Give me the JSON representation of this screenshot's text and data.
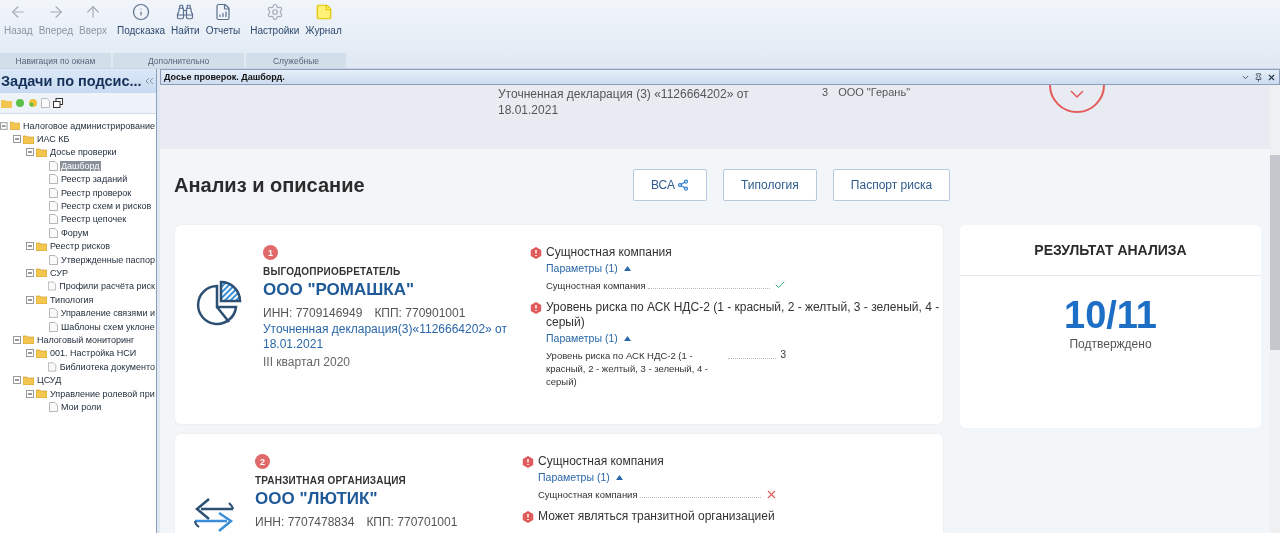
{
  "toolbar": {
    "groups": [
      {
        "label": "Навигация по окнам",
        "buttons": [
          {
            "kind": "back",
            "label": "Назад",
            "disabled": true
          },
          {
            "kind": "forward",
            "label": "Вперед",
            "disabled": true
          },
          {
            "kind": "up",
            "label": "Вверх",
            "disabled": true
          }
        ]
      },
      {
        "label": "Дополнительно",
        "buttons": [
          {
            "kind": "info",
            "label": "Подсказка",
            "disabled": false
          },
          {
            "kind": "find",
            "label": "Найти",
            "disabled": false
          },
          {
            "kind": "reports",
            "label": "Отчеты",
            "disabled": false
          }
        ]
      },
      {
        "label": "Служебные",
        "buttons": [
          {
            "kind": "settings",
            "label": "Настройки",
            "disabled": false
          },
          {
            "kind": "journal",
            "label": "Журнал",
            "disabled": false
          }
        ]
      }
    ]
  },
  "sidebar": {
    "title": "Задачи по подсис...",
    "tree": [
      {
        "label": "Налоговое администрирование",
        "kind": "folder",
        "expanded": true,
        "selected": false,
        "children": [
          {
            "label": "ИАС КБ",
            "kind": "folder",
            "expanded": true,
            "selected": false,
            "children": [
              {
                "label": "Досье проверки",
                "kind": "folder",
                "expanded": true,
                "selected": false,
                "children": [
                  {
                    "label": "Дашборд",
                    "kind": "page",
                    "selected": true
                  },
                  {
                    "label": "Реестр заданий",
                    "kind": "page",
                    "selected": false
                  },
                  {
                    "label": "Реестр проверок",
                    "kind": "page",
                    "selected": false
                  },
                  {
                    "label": "Реестр схем и рисков",
                    "kind": "page",
                    "selected": false
                  },
                  {
                    "label": "Реестр цепочек",
                    "kind": "page",
                    "selected": false
                  },
                  {
                    "label": "Форум",
                    "kind": "page",
                    "selected": false
                  }
                ]
              },
              {
                "label": "Реестр рисков",
                "kind": "folder",
                "expanded": true,
                "selected": false,
                "children": [
                  {
                    "label": "Утвержденные паспор",
                    "kind": "page",
                    "selected": false
                  }
                ]
              },
              {
                "label": "СУР",
                "kind": "folder",
                "expanded": true,
                "selected": false,
                "children": [
                  {
                    "label": "Профили расчёта риск",
                    "kind": "page",
                    "selected": false
                  }
                ]
              },
              {
                "label": "Типология",
                "kind": "folder",
                "expanded": true,
                "selected": false,
                "children": [
                  {
                    "label": "Управление связями и",
                    "kind": "page",
                    "selected": false
                  },
                  {
                    "label": "Шаблоны схем уклоне",
                    "kind": "page",
                    "selected": false
                  }
                ]
              }
            ]
          },
          {
            "label": "Налоговый мониторинг",
            "kind": "folder",
            "expanded": true,
            "selected": false,
            "children": [
              {
                "label": "001. Настройка НСИ",
                "kind": "folder",
                "expanded": true,
                "selected": false,
                "children": [
                  {
                    "label": "Библиотека документо",
                    "kind": "page",
                    "selected": false
                  }
                ]
              }
            ]
          },
          {
            "label": "ЦСУД",
            "kind": "folder",
            "expanded": true,
            "selected": false,
            "children": [
              {
                "label": "Управление ролевой при",
                "kind": "folder",
                "expanded": true,
                "selected": false,
                "children": [
                  {
                    "label": "Мои роли",
                    "kind": "page",
                    "selected": false
                  }
                ]
              }
            ]
          }
        ]
      }
    ]
  },
  "panel": {
    "title": "Досье проверок. Дашборд.",
    "top_strip": {
      "declaration": "Уточненная декларация (3) «1126664202» от",
      "date": "18.01.2021",
      "number": "3",
      "company": "ООО \"Герань\""
    },
    "section_title": "Анализ и описание",
    "buttons": [
      {
        "label": "ВСА",
        "icon": true
      },
      {
        "label": "Типология",
        "icon": false
      },
      {
        "label": "Паспорт риска",
        "icon": false
      }
    ],
    "entities": [
      {
        "number": "1",
        "kind": "beneficiary",
        "role": "ВЫГОДОПРИОБРЕТАТЕЛЬ",
        "name": "ООО \"РОМАШКА\"",
        "inn": "ИНН: 7709146949",
        "kpp": "КПП: 770901001",
        "declaration": "Уточненная декларация(3)«1126664202» от 18.01.2021",
        "period": "III квартал 2020",
        "criteria": [
          {
            "title": "Сущностная компания",
            "params": "Параметры (1)",
            "rows": [
              {
                "name": "Сущностная компания",
                "kind": "check"
              }
            ]
          },
          {
            "title": "Уровень риска по АСК НДС-2 (1 - красный, 2 - желтый, 3 - зеленый, 4 - серый)",
            "params": "Параметры (1)",
            "rows": [
              {
                "name": "Уровень риска по АСК НДС-2 (1 - красный, 2 - желтый, 3 - зеленый, 4 - серый)",
                "kind": "value",
                "value": "3"
              }
            ]
          }
        ]
      },
      {
        "number": "2",
        "kind": "transit",
        "role": "ТРАНЗИТНАЯ ОРГАНИЗАЦИЯ",
        "name": "ООО \"ЛЮТИК\"",
        "inn": "ИНН: 7707478834",
        "kpp": "КПП: 770701001",
        "criteria": [
          {
            "title": "Сущностная компания",
            "params": "Параметры (1)",
            "rows": [
              {
                "name": "Сущностная компания",
                "kind": "cross"
              }
            ]
          },
          {
            "title": "Может являться транзитной организацией"
          }
        ]
      }
    ],
    "result": {
      "title": "РЕЗУЛЬТАТ АНАЛИЗА",
      "value": "10/11",
      "caption": "Подтверждено"
    }
  }
}
